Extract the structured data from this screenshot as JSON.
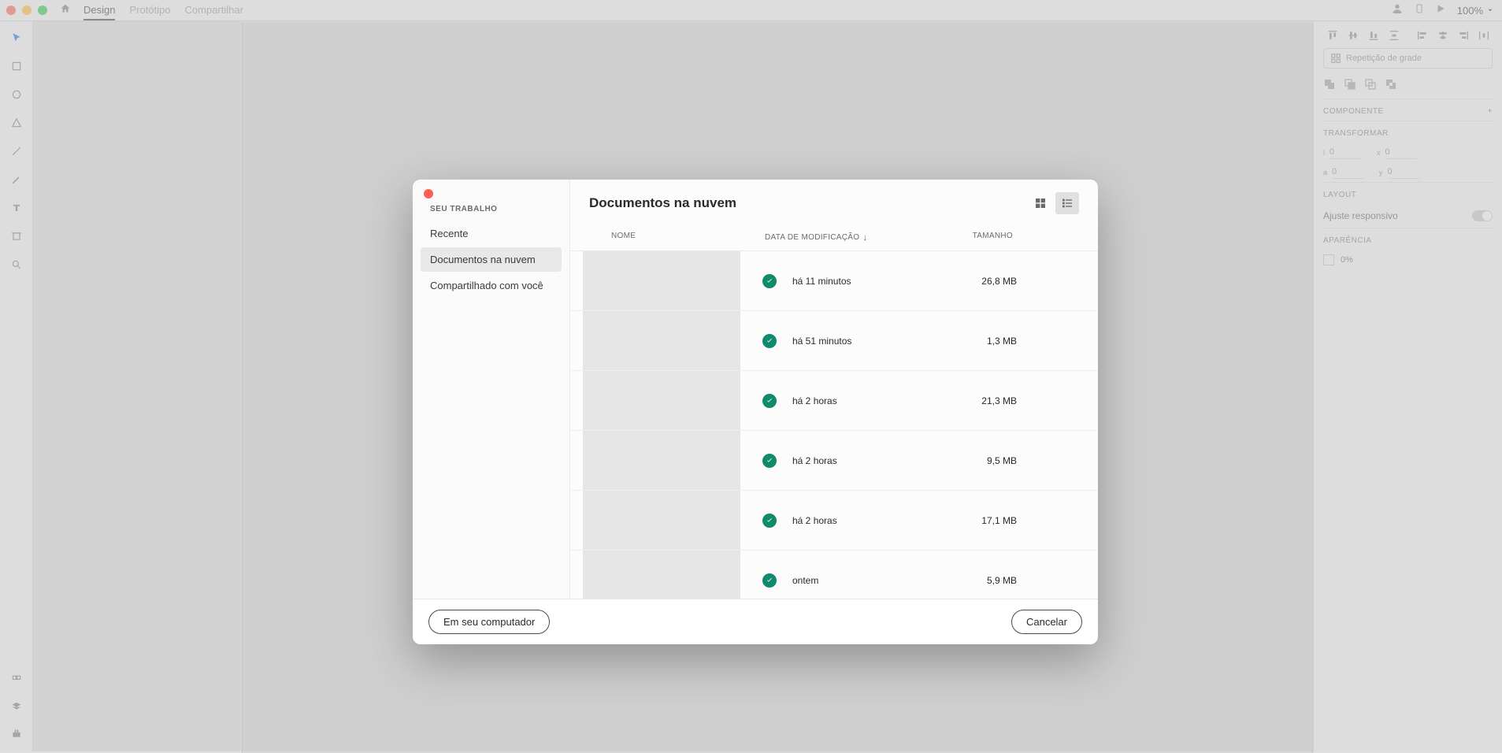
{
  "menubar": {
    "tabs": [
      "Design",
      "Protótipo",
      "Compartilhar"
    ],
    "zoom": "100%"
  },
  "rightPanel": {
    "repeatGrid": "Repetição de grade",
    "component": "COMPONENTE",
    "transform": "TRANSFORMAR",
    "layout": "LAYOUT",
    "responsive": "Ajuste responsivo",
    "appearance": "APARÊNCIA",
    "opacity": "0%",
    "l": "L",
    "x": "X",
    "a": "A",
    "y": "Y",
    "v0a": "0",
    "v0b": "0",
    "v0c": "0",
    "v0d": "0"
  },
  "modal": {
    "sidebarTitle": "SEU TRABALHO",
    "nav": {
      "recent": "Recente",
      "cloud": "Documentos na nuvem",
      "shared": "Compartilhado com você"
    },
    "title": "Documentos na nuvem",
    "columns": {
      "name": "NOME",
      "date": "DATA DE MODIFICAÇÃO",
      "size": "TAMANHO"
    },
    "rows": [
      {
        "date": "há 11 minutos",
        "size": "26,8 MB"
      },
      {
        "date": "há 51 minutos",
        "size": "1,3 MB"
      },
      {
        "date": "há 2 horas",
        "size": "21,3 MB"
      },
      {
        "date": "há 2 horas",
        "size": "9,5 MB"
      },
      {
        "date": "há 2 horas",
        "size": "17,1 MB"
      },
      {
        "date": "ontem",
        "size": "5,9 MB"
      }
    ],
    "footer": {
      "computer": "Em seu computador",
      "cancel": "Cancelar"
    }
  }
}
